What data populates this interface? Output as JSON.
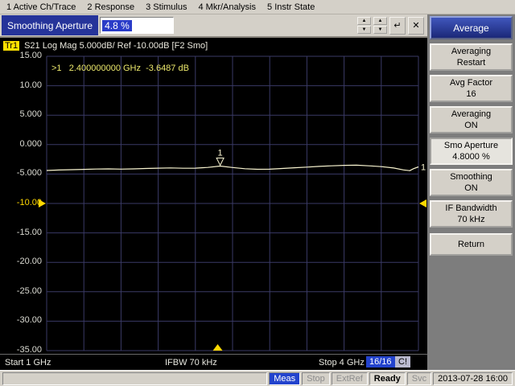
{
  "colors": {
    "grid": "#3a3a66",
    "trace": "#f8f4d0",
    "marker_yellow": "#ffd800",
    "accent_blue": "#2343cd"
  },
  "menu_bar": {
    "items": [
      "1 Active Ch/Trace",
      "2 Response",
      "3 Stimulus",
      "4 Mkr/Analysis",
      "5 Instr State"
    ]
  },
  "entry_bar": {
    "label": "Smoothing Aperture",
    "value": "4.8 %",
    "spin_up_icon": "▲",
    "spin_down_icon": "▼",
    "enter_icon": "↵",
    "close_icon": "✕"
  },
  "trace_header": {
    "trace_label": "Tr1",
    "settings": "S21 Log Mag 5.000dB/ Ref -10.00dB [F2 Smo]"
  },
  "marker_readout": ">1   2.400000000 GHz  -3.6487 dB",
  "plot_footer": {
    "start": "Start 1 GHz",
    "ifbw": "IFBW 70 kHz",
    "stop": "Stop 4 GHz",
    "avg_count": "16/16",
    "cal_status": "C!"
  },
  "softkeys": {
    "title": "Average",
    "buttons": [
      {
        "line1": "Averaging",
        "line2": "Restart"
      },
      {
        "line1": "Avg Factor",
        "line2": "16"
      },
      {
        "line1": "Averaging",
        "line2": "ON"
      },
      {
        "line1": "Smo Aperture",
        "line2": "4.8000 %"
      },
      {
        "line1": "Smoothing",
        "line2": "ON"
      },
      {
        "line1": "IF Bandwidth",
        "line2": "70 kHz"
      },
      {
        "line1": "Return",
        "line2": ""
      }
    ]
  },
  "status_bar": {
    "meas": "Meas",
    "stop": "Stop",
    "extref": "ExtRef",
    "ready": "Ready",
    "svc": "Svc",
    "datetime": "2013-07-28 16:00"
  },
  "chart_data": {
    "type": "line",
    "title": "Tr1 S21 Log Mag",
    "x_unit": "GHz",
    "x_range": [
      1,
      4
    ],
    "y_unit": "dB",
    "y_range": [
      -35,
      15
    ],
    "scale_per_div": 5,
    "ref_level": -10,
    "grid_divisions": 10,
    "y_tick_labels": [
      "15.00",
      "10.00",
      "5.000",
      "0.000",
      "-5.000",
      "-10.00",
      "-15.00",
      "-20.00",
      "-25.00",
      "-30.00",
      "-35.00"
    ],
    "trace_number": "1",
    "marker": {
      "label": "1",
      "x": 2.4,
      "y": -3.6487
    },
    "sweep_position": 2.38,
    "series": [
      {
        "name": "S21",
        "points": [
          [
            1.0,
            -4.4
          ],
          [
            1.1,
            -4.32
          ],
          [
            1.2,
            -4.26
          ],
          [
            1.3,
            -4.21
          ],
          [
            1.4,
            -4.15
          ],
          [
            1.5,
            -4.12
          ],
          [
            1.6,
            -4.16
          ],
          [
            1.7,
            -4.12
          ],
          [
            1.8,
            -4.06
          ],
          [
            1.9,
            -4.0
          ],
          [
            2.0,
            -3.96
          ],
          [
            2.1,
            -4.02
          ],
          [
            2.2,
            -4.0
          ],
          [
            2.3,
            -3.88
          ],
          [
            2.4,
            -3.65
          ],
          [
            2.5,
            -3.9
          ],
          [
            2.6,
            -4.1
          ],
          [
            2.7,
            -4.2
          ],
          [
            2.8,
            -4.18
          ],
          [
            2.9,
            -4.06
          ],
          [
            3.0,
            -3.94
          ],
          [
            3.1,
            -3.82
          ],
          [
            3.2,
            -3.7
          ],
          [
            3.3,
            -3.6
          ],
          [
            3.4,
            -3.52
          ],
          [
            3.5,
            -3.5
          ],
          [
            3.6,
            -3.6
          ],
          [
            3.7,
            -3.74
          ],
          [
            3.8,
            -3.98
          ],
          [
            3.88,
            -4.3
          ],
          [
            3.93,
            -4.42
          ],
          [
            3.96,
            -4.1
          ],
          [
            4.0,
            -3.78
          ]
        ]
      }
    ]
  }
}
